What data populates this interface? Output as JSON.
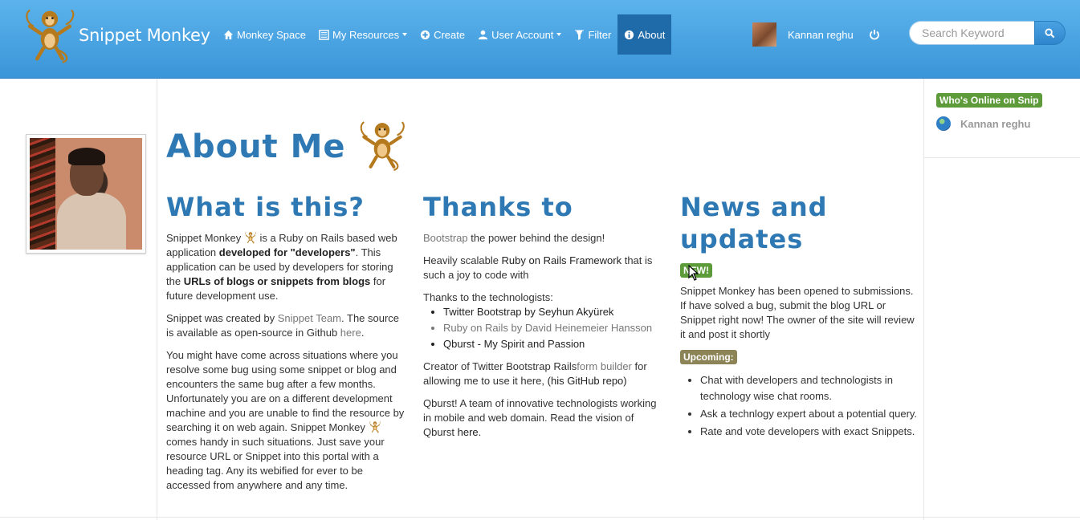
{
  "brand": {
    "name": "Snippet Monkey"
  },
  "nav": {
    "items": [
      {
        "label": "Monkey Space"
      },
      {
        "label": "My Resources"
      },
      {
        "label": "Create"
      },
      {
        "label": "User Account"
      },
      {
        "label": "Filter"
      },
      {
        "label": "About"
      }
    ],
    "active": "About"
  },
  "user": {
    "name": "Kannan reghu"
  },
  "search": {
    "placeholder": "Search Keyword",
    "value": ""
  },
  "sidebar_right": {
    "online_title": "Who's Online on Snip",
    "online_user": "Kannan reghu"
  },
  "page": {
    "title": "About Me"
  },
  "col1": {
    "heading": "What is this?",
    "p1_a": "Snippet Monkey ",
    "p1_b": " is a Ruby on Rails based web application ",
    "p1_bold1": "developed for \"developers\"",
    "p1_c": ". This application can be used by developers for storing the ",
    "p1_bold2": "URLs of blogs or snippets from blogs",
    "p1_d": " for future development use.",
    "p2_a": "Snippet was created by ",
    "p2_link": "Snippet Team",
    "p2_b": ". The source is available as open-source in Github ",
    "p2_link2": "here",
    "p2_c": ".",
    "p3_a": "You might have come across situations where you resolve some bug using some snippet or blog and encounters the same bug after a few months. Unfortunately you are on a different development machine and you are unable to find the resource by searching it on web again. Snippet Monkey ",
    "p3_b": " comes handy in such situations. Just save your resource URL or Snippet into this portal with a heading tag. Any its webified for ever to be accessed from anywhere and any time."
  },
  "col2": {
    "heading": "Thanks to",
    "p1_link": "Bootstrap",
    "p1_rest": " the power behind the design!",
    "p2_a": "Heavily scalable ",
    "p2_link": "Ruby on Rails Framework",
    "p2_b": " that is such a joy to code with",
    "p3": "Thanks to the technologists:",
    "list": [
      "Twitter Bootstrap by Seyhun Akyürek",
      "Ruby on Rails by David Heinemeier Hansson",
      "Qburst - My Spirit and Passion"
    ],
    "p4_a": "Creator of Twitter Bootstrap Rails",
    "p4_link": "form builder",
    "p4_b": " for allowing me to use it here, ",
    "p4_link2": "(his GitHub repo)",
    "p5_a": "Qburst! A team of innovative technologists working in mobile and web domain. Read the vision of Qburst ",
    "p5_link": "here."
  },
  "col3": {
    "heading": "News and updates",
    "badge_new": "NEW!",
    "p1": "Snippet Monkey has been opened to submissions. If have solved a bug, submit the blog URL or Snippet right now! The owner of the site will review it and post it shortly",
    "badge_upcoming": "Upcoming:",
    "list": [
      "Chat with developers and technologists in technology wise chat rooms.",
      "Ask a technlogy expert about a potential query.",
      "Rate and vote developers with exact Snippets."
    ]
  },
  "colors": {
    "accent": "#2e79b3",
    "navbar": "#4aa5e4",
    "badge_green": "#5c9a3a",
    "badge_olive": "#8c8456"
  }
}
